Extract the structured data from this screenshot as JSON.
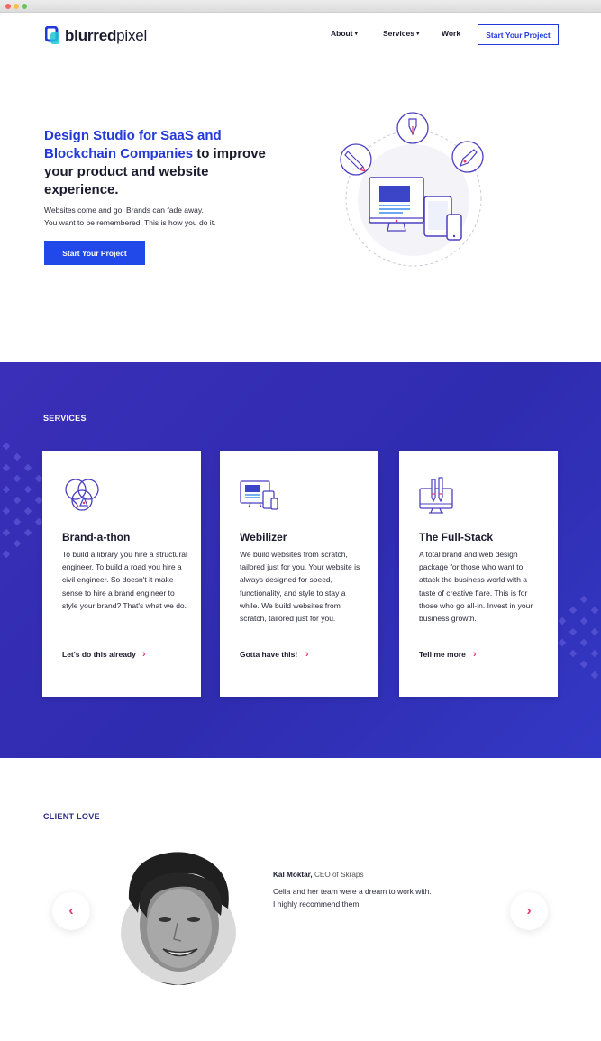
{
  "brand": {
    "name_bold": "blurred",
    "name_light": "pixel"
  },
  "nav": {
    "items": [
      {
        "label": "About",
        "has_dropdown": true
      },
      {
        "label": "Services",
        "has_dropdown": true
      },
      {
        "label": "Work",
        "has_dropdown": false
      }
    ],
    "cta_label": "Start Your Project"
  },
  "hero": {
    "title_accent": "Design Studio for SaaS and Blockchain Companies",
    "title_rest": " to improve your product and website experience.",
    "subtitle_line1": "Websites come and go. Brands can fade away.",
    "subtitle_line2": "You want to be remembered. This is how you do it.",
    "cta_label": "Start Your Project"
  },
  "services": {
    "section_title": "SERVICES",
    "cards": [
      {
        "icon": "venn-pencil-icon",
        "title": "Brand-a-thon",
        "text": "To build a library you hire a structural engineer. To build a road you hire a civil engineer. So doesn't it make sense to hire a brand engineer to style your brand? That's what we do.",
        "link_label": "Let's do this already"
      },
      {
        "icon": "devices-icon",
        "title": "Webilizer",
        "text": "We build websites from scratch, tailored just for you. Your website is always designed for speed, functionality, and style to stay a while. We build websites from scratch, tailored just for you.",
        "link_label": "Gotta have this!"
      },
      {
        "icon": "monitor-pencils-icon",
        "title": "The Full-Stack",
        "text": "A total brand and web design package for those who want to attack the business world with a taste of creative flare. This is for those who go all-in. Invest in your business growth.",
        "link_label": "Tell me more"
      }
    ]
  },
  "testimonials": {
    "section_title": "CLIENT LOVE",
    "current": {
      "name": "Kal Moktar,",
      "role": " CEO of Skraps",
      "quote_line1": "Celia and her team were a dream to work with.",
      "quote_line2": "I highly recommend them!"
    }
  },
  "colors": {
    "primary": "#2339d9",
    "services_bg": "#3330b8",
    "accent_pink": "#e13a6e",
    "text_dark": "#1b1b2e"
  }
}
